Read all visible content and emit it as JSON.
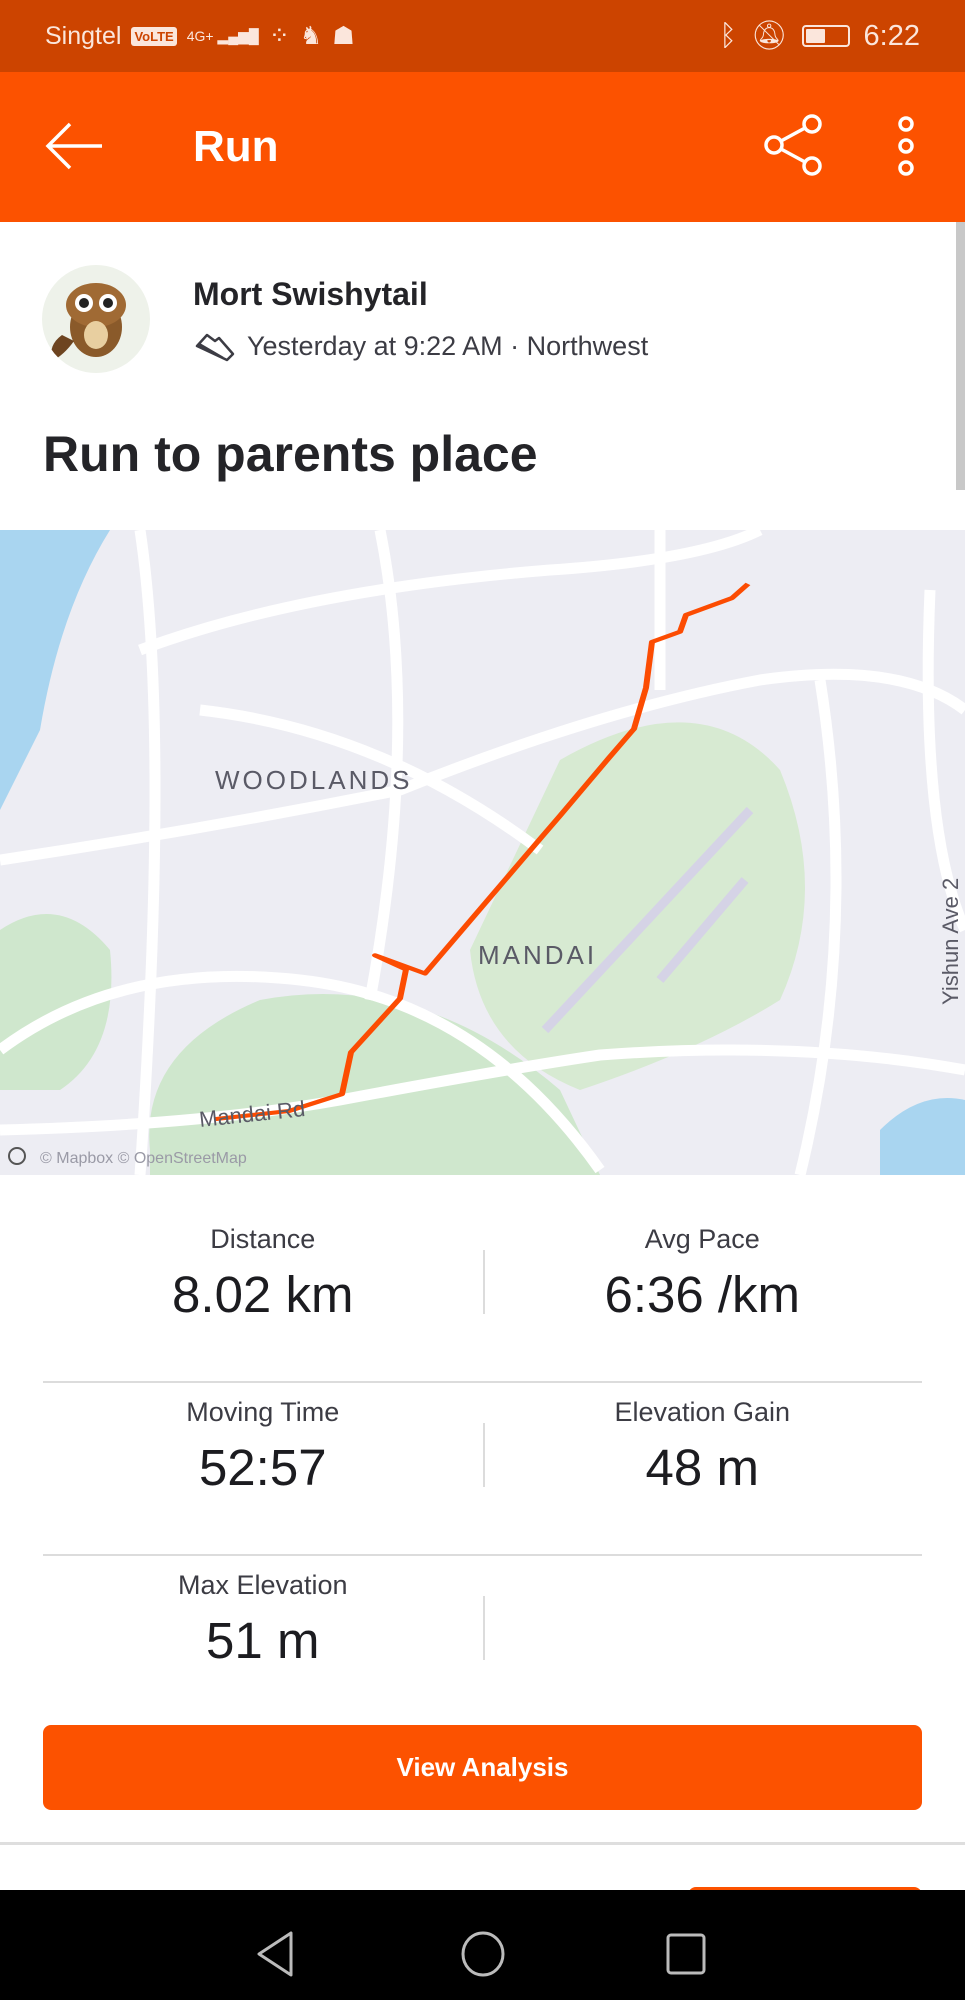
{
  "status_bar": {
    "carrier": "Singtel",
    "volte": "VoLTE",
    "network": "4G+",
    "time": "6:22"
  },
  "app_bar": {
    "title": "Run",
    "back_icon": "arrow-left-icon",
    "share_icon": "share-icon",
    "more_icon": "more-vertical-icon"
  },
  "activity": {
    "athlete_name": "Mort Swishytail",
    "sport_icon": "shoe-icon",
    "date_location": "Yesterday at 9:22 AM · Northwest",
    "title": "Run to parents place"
  },
  "map": {
    "labels": {
      "area1": "WOODLANDS",
      "area2": "MANDAI",
      "road1": "Mandai Rd",
      "road2": "Yishun Ave 2"
    },
    "attribution": "© Mapbox  © OpenStreetMap",
    "route_color": "#fc4c02"
  },
  "stats": [
    {
      "label": "Distance",
      "value": "8.02 km"
    },
    {
      "label": "Avg Pace",
      "value": "6:36 /km"
    },
    {
      "label": "Moving Time",
      "value": "52:57"
    },
    {
      "label": "Elevation Gain",
      "value": "48 m"
    },
    {
      "label": "Max Elevation",
      "value": "51 m"
    }
  ],
  "view_analysis_label": "View Analysis",
  "colors": {
    "brand": "#fc5200",
    "status_bar": "#cc4400"
  }
}
